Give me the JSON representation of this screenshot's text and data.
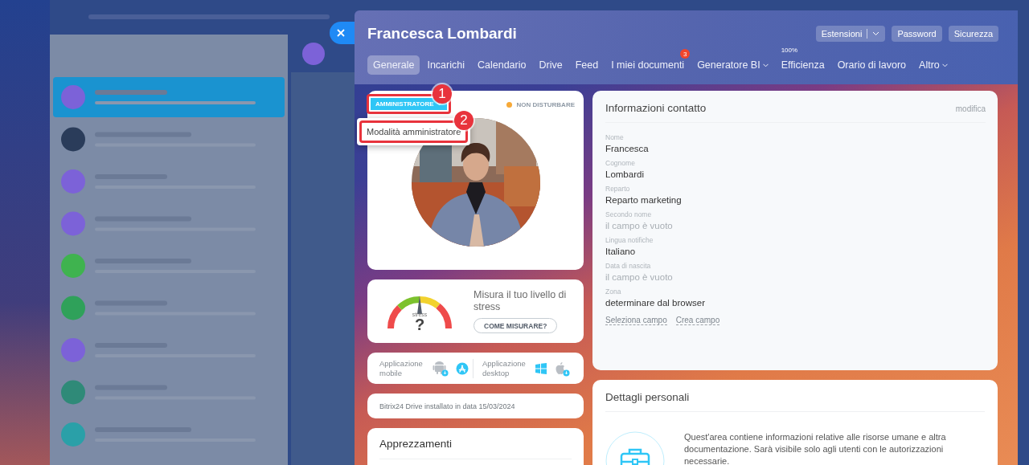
{
  "panel": {
    "title": "Francesca Lombardi",
    "header_buttons": [
      {
        "label": "Estensioni",
        "kind": "split"
      },
      {
        "label": "Password",
        "kind": "plain"
      },
      {
        "label": "Sicurezza",
        "kind": "plain"
      }
    ]
  },
  "tabs": [
    {
      "label": "Generale",
      "selected": true
    },
    {
      "label": "Incarichi",
      "selected": false
    },
    {
      "label": "Calendario",
      "selected": false
    },
    {
      "label": "Drive",
      "selected": false
    },
    {
      "label": "Feed",
      "selected": false
    },
    {
      "label": "I miei documenti",
      "selected": false,
      "badge": "3"
    },
    {
      "label": "Generatore BI",
      "selected": false,
      "dropdown": true
    },
    {
      "label": "Efficienza",
      "selected": false,
      "superscript": "100%"
    },
    {
      "label": "Orario di lavoro",
      "selected": false
    },
    {
      "label": "Altro",
      "selected": false,
      "dropdown": true
    }
  ],
  "profile": {
    "role_button": "AMMINISTRATORE",
    "role_callout": "1",
    "status": "NON DISTURBARE",
    "menu_item": "Modalità amministratore",
    "menu_callout": "2"
  },
  "stress": {
    "gauge_label": "stress",
    "reading": "?",
    "text": "Misura il tuo livello di stress",
    "button": "COME MISURARE?"
  },
  "apps": [
    {
      "label": "Applicazione mobile",
      "platforms": [
        {
          "kind": "android"
        },
        {
          "kind": "appstore"
        }
      ]
    },
    {
      "label": "Applicazione desktop",
      "platforms": [
        {
          "kind": "windows"
        },
        {
          "kind": "apple"
        }
      ]
    }
  ],
  "drive_status": "Bitrix24 Drive installato in data 15/03/2024",
  "appreciations": {
    "title": "Apprezzamenti"
  },
  "contact": {
    "title": "Informazioni contatto",
    "edit_link": "modifica",
    "fields": [
      {
        "label": "Nome",
        "value": "Francesca",
        "empty": false
      },
      {
        "label": "Cognome",
        "value": "Lombardi",
        "empty": false
      },
      {
        "label": "Reparto",
        "value": "Reparto marketing",
        "empty": false
      },
      {
        "label": "Secondo nome",
        "value": "il campo è vuoto",
        "empty": true
      },
      {
        "label": "Lingua notifiche",
        "value": "Italiano",
        "empty": false
      },
      {
        "label": "Data di nascita",
        "value": "il campo è vuoto",
        "empty": true
      },
      {
        "label": "Zona",
        "value": "determinare dal browser",
        "empty": false
      }
    ],
    "links": [
      "Seleziona campo",
      "Crea campo"
    ]
  },
  "personal": {
    "title": "Dettagli personali",
    "text": "Quest'area contiene informazioni relative alle risorse umane e altra documentazione. Sarà visibile solo agli utenti con le autorizzazioni necessarie."
  }
}
